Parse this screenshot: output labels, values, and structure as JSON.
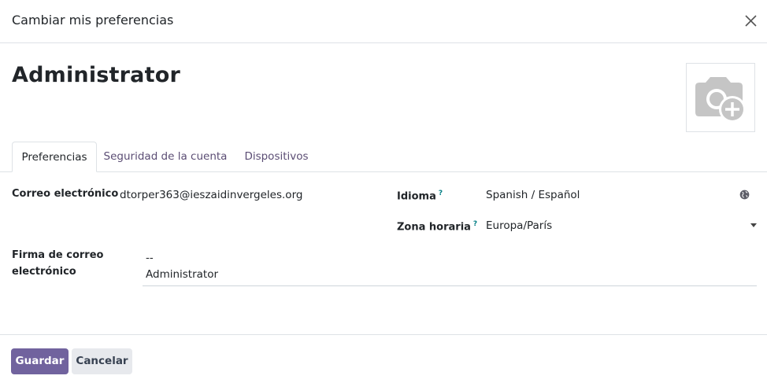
{
  "dialog": {
    "title": "Cambiar mis preferencias"
  },
  "user": {
    "name": "Administrator"
  },
  "tabs": [
    {
      "label": "Preferencias",
      "active": true
    },
    {
      "label": "Seguridad de la cuenta",
      "active": false
    },
    {
      "label": "Dispositivos",
      "active": false
    }
  ],
  "fields": {
    "email": {
      "label": "Correo electrónico",
      "value": "dtorper363@ieszaidinvergeles.org"
    },
    "language": {
      "label": "Idioma",
      "help": "?",
      "value": "Spanish / Español"
    },
    "timezone": {
      "label": "Zona horaria",
      "help": "?",
      "value": "Europa/París"
    },
    "signature": {
      "label_line1": "Firma de correo",
      "label_line2": "electrónico",
      "line1": "--",
      "line2": "Administrator"
    }
  },
  "footer": {
    "save_label": "Guardar",
    "cancel_label": "Cancelar"
  },
  "colors": {
    "primary": "#71639e",
    "secondary": "#e7e9ed",
    "tab_link": "#5b4d74",
    "help": "#017e84"
  }
}
